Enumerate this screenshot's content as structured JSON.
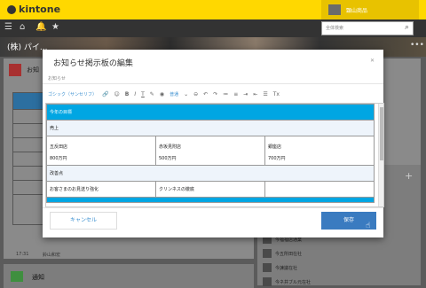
{
  "app": {
    "logo_text": "kintone"
  },
  "header": {
    "user_name": "顕山商品"
  },
  "search": {
    "placeholder": "全体検索"
  },
  "banner": {
    "text": "(株) パイ..."
  },
  "left_panel": {
    "title": "お知",
    "time": "17:31",
    "editor_name": "鈴山和宏"
  },
  "members": [
    "今福福店通業",
    "今五所田在社",
    "今諫議在社",
    "今ネ井ブル元在社"
  ],
  "bottom_panel": {
    "title": "通知"
  },
  "modal": {
    "title": "お知らせ掲示板の編集",
    "label": "お知らせ",
    "toolbar": {
      "font": "ゴシック（サンセリフ）",
      "size": "普通"
    },
    "table": {
      "header": "今年の目標",
      "section1": "売上",
      "stores": [
        {
          "name": "五反田店",
          "value": "800万円"
        },
        {
          "name": "赤坂見附店",
          "value": "500万円"
        },
        {
          "name": "銀座店",
          "value": "700万円"
        }
      ],
      "section2": "改善点",
      "improvements": [
        "お客さまのお見送り強化",
        "クリンネスの徹底",
        ""
      ]
    },
    "cancel_label": "キャンセル",
    "save_label": "保存"
  },
  "colors": {
    "topbar": "#ffd800",
    "table_header": "#00a6e3",
    "save_button": "#3a7bc0"
  }
}
